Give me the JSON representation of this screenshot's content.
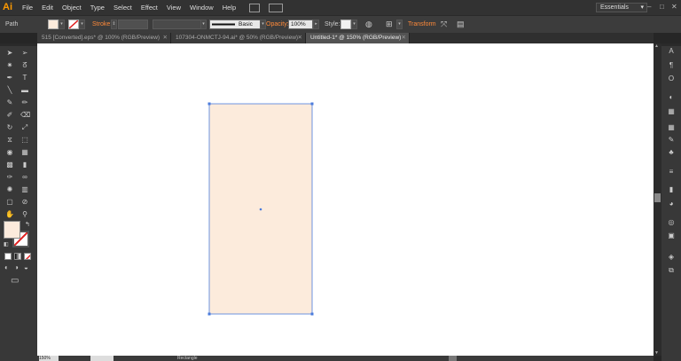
{
  "app": {
    "logo": "Ai"
  },
  "menu": [
    "File",
    "Edit",
    "Object",
    "Type",
    "Select",
    "Effect",
    "View",
    "Window",
    "Help"
  ],
  "workspace": {
    "label": "Essentials",
    "arrow": "▾"
  },
  "window_controls": {
    "minimize": "–",
    "maximize": "□",
    "close": "✕"
  },
  "control_bar": {
    "selection_type": "Path",
    "stroke_link": "Stroke:",
    "brush_label": "Basic",
    "opacity_link": "Opacity:",
    "opacity_value": "100%",
    "style_label": "Style:",
    "transform_link": "Transform",
    "fill_color": "#fcebdc"
  },
  "tabs": [
    {
      "label": "515 [Converted].eps* @ 100% (RGB/Preview)",
      "close": "✕"
    },
    {
      "label": "107304-ONMCTJ-94.ai* @ 50% (RGB/Preview)",
      "close": "✕"
    },
    {
      "label": "Untitled-1* @ 150% (RGB/Preview)",
      "close": "✕",
      "active": true
    }
  ],
  "toolbox": {
    "tools": [
      "selection-tool",
      "direct-selection-tool",
      "magic-wand-tool",
      "lasso-tool",
      "pen-tool",
      "type-tool",
      "line-segment-tool",
      "rectangle-tool",
      "paintbrush-tool",
      "pencil-tool",
      "blob-brush-tool",
      "eraser-tool",
      "rotate-tool",
      "scale-tool",
      "width-tool",
      "free-transform-tool",
      "shape-builder-tool",
      "perspective-grid-tool",
      "mesh-tool",
      "gradient-tool",
      "eyedropper-tool",
      "blend-tool",
      "symbol-sprayer-tool",
      "column-graph-tool",
      "artboard-tool",
      "slice-tool",
      "hand-tool",
      "zoom-tool"
    ],
    "fill_color": "#fcebdc",
    "stroke_color": "#ffffff"
  },
  "canvas": {
    "shape": "rectangle",
    "fill": "#fcebdc",
    "selection_color": "#4a7bdc"
  },
  "status": {
    "zoom": "150%",
    "tool": "Rectangle"
  }
}
